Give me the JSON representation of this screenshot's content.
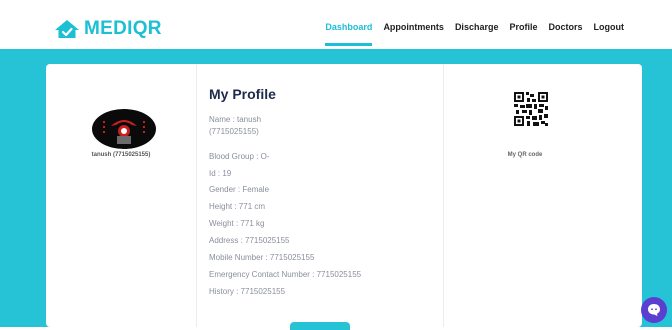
{
  "brand": {
    "name": "MEDIQR"
  },
  "nav": {
    "dashboard": "Dashboard",
    "appointments": "Appointments",
    "discharge": "Discharge",
    "profile": "Profile",
    "doctors": "Doctors",
    "logout": "Logout"
  },
  "avatar": {
    "caption": "tanush (7715025155)"
  },
  "profile": {
    "title": "My Profile",
    "name_line1": "Name : tanush",
    "name_line2": "(7715025155)",
    "blood_group": "Blood Group : O-",
    "id": "Id : 19",
    "gender": "Gender : Female",
    "height": "Height : 771 cm",
    "weight": "Weight : 771 kg",
    "address": "Address : 7715025155",
    "mobile": "Mobile Number : 7715025155",
    "emergency": "Emergency Contact Number : 7715025155",
    "history": "History : 7715025155"
  },
  "qr": {
    "caption": "My QR code"
  },
  "colors": {
    "accent": "#1cbfd4",
    "band": "#26c3d6",
    "chat": "#5b3fd1"
  },
  "icons": {
    "logo": "home-icon",
    "chat": "chat-icon"
  }
}
